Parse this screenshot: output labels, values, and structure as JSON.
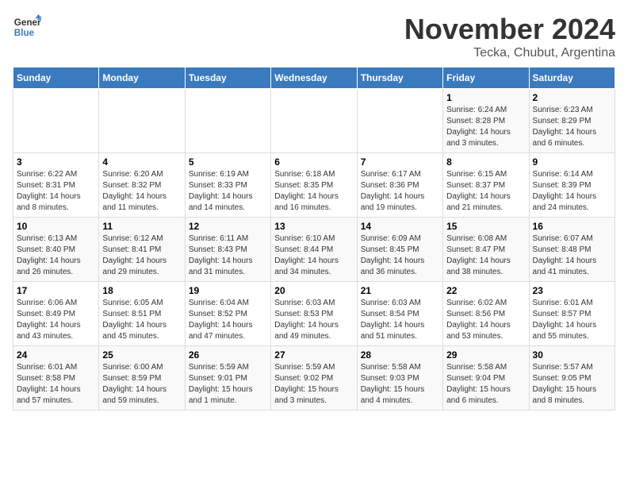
{
  "logo": {
    "line1": "General",
    "line2": "Blue"
  },
  "title": "November 2024",
  "location": "Tecka, Chubut, Argentina",
  "weekdays": [
    "Sunday",
    "Monday",
    "Tuesday",
    "Wednesday",
    "Thursday",
    "Friday",
    "Saturday"
  ],
  "weeks": [
    [
      {
        "day": "",
        "detail": ""
      },
      {
        "day": "",
        "detail": ""
      },
      {
        "day": "",
        "detail": ""
      },
      {
        "day": "",
        "detail": ""
      },
      {
        "day": "",
        "detail": ""
      },
      {
        "day": "1",
        "detail": "Sunrise: 6:24 AM\nSunset: 8:28 PM\nDaylight: 14 hours and 3 minutes."
      },
      {
        "day": "2",
        "detail": "Sunrise: 6:23 AM\nSunset: 8:29 PM\nDaylight: 14 hours and 6 minutes."
      }
    ],
    [
      {
        "day": "3",
        "detail": "Sunrise: 6:22 AM\nSunset: 8:31 PM\nDaylight: 14 hours and 8 minutes."
      },
      {
        "day": "4",
        "detail": "Sunrise: 6:20 AM\nSunset: 8:32 PM\nDaylight: 14 hours and 11 minutes."
      },
      {
        "day": "5",
        "detail": "Sunrise: 6:19 AM\nSunset: 8:33 PM\nDaylight: 14 hours and 14 minutes."
      },
      {
        "day": "6",
        "detail": "Sunrise: 6:18 AM\nSunset: 8:35 PM\nDaylight: 14 hours and 16 minutes."
      },
      {
        "day": "7",
        "detail": "Sunrise: 6:17 AM\nSunset: 8:36 PM\nDaylight: 14 hours and 19 minutes."
      },
      {
        "day": "8",
        "detail": "Sunrise: 6:15 AM\nSunset: 8:37 PM\nDaylight: 14 hours and 21 minutes."
      },
      {
        "day": "9",
        "detail": "Sunrise: 6:14 AM\nSunset: 8:39 PM\nDaylight: 14 hours and 24 minutes."
      }
    ],
    [
      {
        "day": "10",
        "detail": "Sunrise: 6:13 AM\nSunset: 8:40 PM\nDaylight: 14 hours and 26 minutes."
      },
      {
        "day": "11",
        "detail": "Sunrise: 6:12 AM\nSunset: 8:41 PM\nDaylight: 14 hours and 29 minutes."
      },
      {
        "day": "12",
        "detail": "Sunrise: 6:11 AM\nSunset: 8:43 PM\nDaylight: 14 hours and 31 minutes."
      },
      {
        "day": "13",
        "detail": "Sunrise: 6:10 AM\nSunset: 8:44 PM\nDaylight: 14 hours and 34 minutes."
      },
      {
        "day": "14",
        "detail": "Sunrise: 6:09 AM\nSunset: 8:45 PM\nDaylight: 14 hours and 36 minutes."
      },
      {
        "day": "15",
        "detail": "Sunrise: 6:08 AM\nSunset: 8:47 PM\nDaylight: 14 hours and 38 minutes."
      },
      {
        "day": "16",
        "detail": "Sunrise: 6:07 AM\nSunset: 8:48 PM\nDaylight: 14 hours and 41 minutes."
      }
    ],
    [
      {
        "day": "17",
        "detail": "Sunrise: 6:06 AM\nSunset: 8:49 PM\nDaylight: 14 hours and 43 minutes."
      },
      {
        "day": "18",
        "detail": "Sunrise: 6:05 AM\nSunset: 8:51 PM\nDaylight: 14 hours and 45 minutes."
      },
      {
        "day": "19",
        "detail": "Sunrise: 6:04 AM\nSunset: 8:52 PM\nDaylight: 14 hours and 47 minutes."
      },
      {
        "day": "20",
        "detail": "Sunrise: 6:03 AM\nSunset: 8:53 PM\nDaylight: 14 hours and 49 minutes."
      },
      {
        "day": "21",
        "detail": "Sunrise: 6:03 AM\nSunset: 8:54 PM\nDaylight: 14 hours and 51 minutes."
      },
      {
        "day": "22",
        "detail": "Sunrise: 6:02 AM\nSunset: 8:56 PM\nDaylight: 14 hours and 53 minutes."
      },
      {
        "day": "23",
        "detail": "Sunrise: 6:01 AM\nSunset: 8:57 PM\nDaylight: 14 hours and 55 minutes."
      }
    ],
    [
      {
        "day": "24",
        "detail": "Sunrise: 6:01 AM\nSunset: 8:58 PM\nDaylight: 14 hours and 57 minutes."
      },
      {
        "day": "25",
        "detail": "Sunrise: 6:00 AM\nSunset: 8:59 PM\nDaylight: 14 hours and 59 minutes."
      },
      {
        "day": "26",
        "detail": "Sunrise: 5:59 AM\nSunset: 9:01 PM\nDaylight: 15 hours and 1 minute."
      },
      {
        "day": "27",
        "detail": "Sunrise: 5:59 AM\nSunset: 9:02 PM\nDaylight: 15 hours and 3 minutes."
      },
      {
        "day": "28",
        "detail": "Sunrise: 5:58 AM\nSunset: 9:03 PM\nDaylight: 15 hours and 4 minutes."
      },
      {
        "day": "29",
        "detail": "Sunrise: 5:58 AM\nSunset: 9:04 PM\nDaylight: 15 hours and 6 minutes."
      },
      {
        "day": "30",
        "detail": "Sunrise: 5:57 AM\nSunset: 9:05 PM\nDaylight: 15 hours and 8 minutes."
      }
    ]
  ]
}
